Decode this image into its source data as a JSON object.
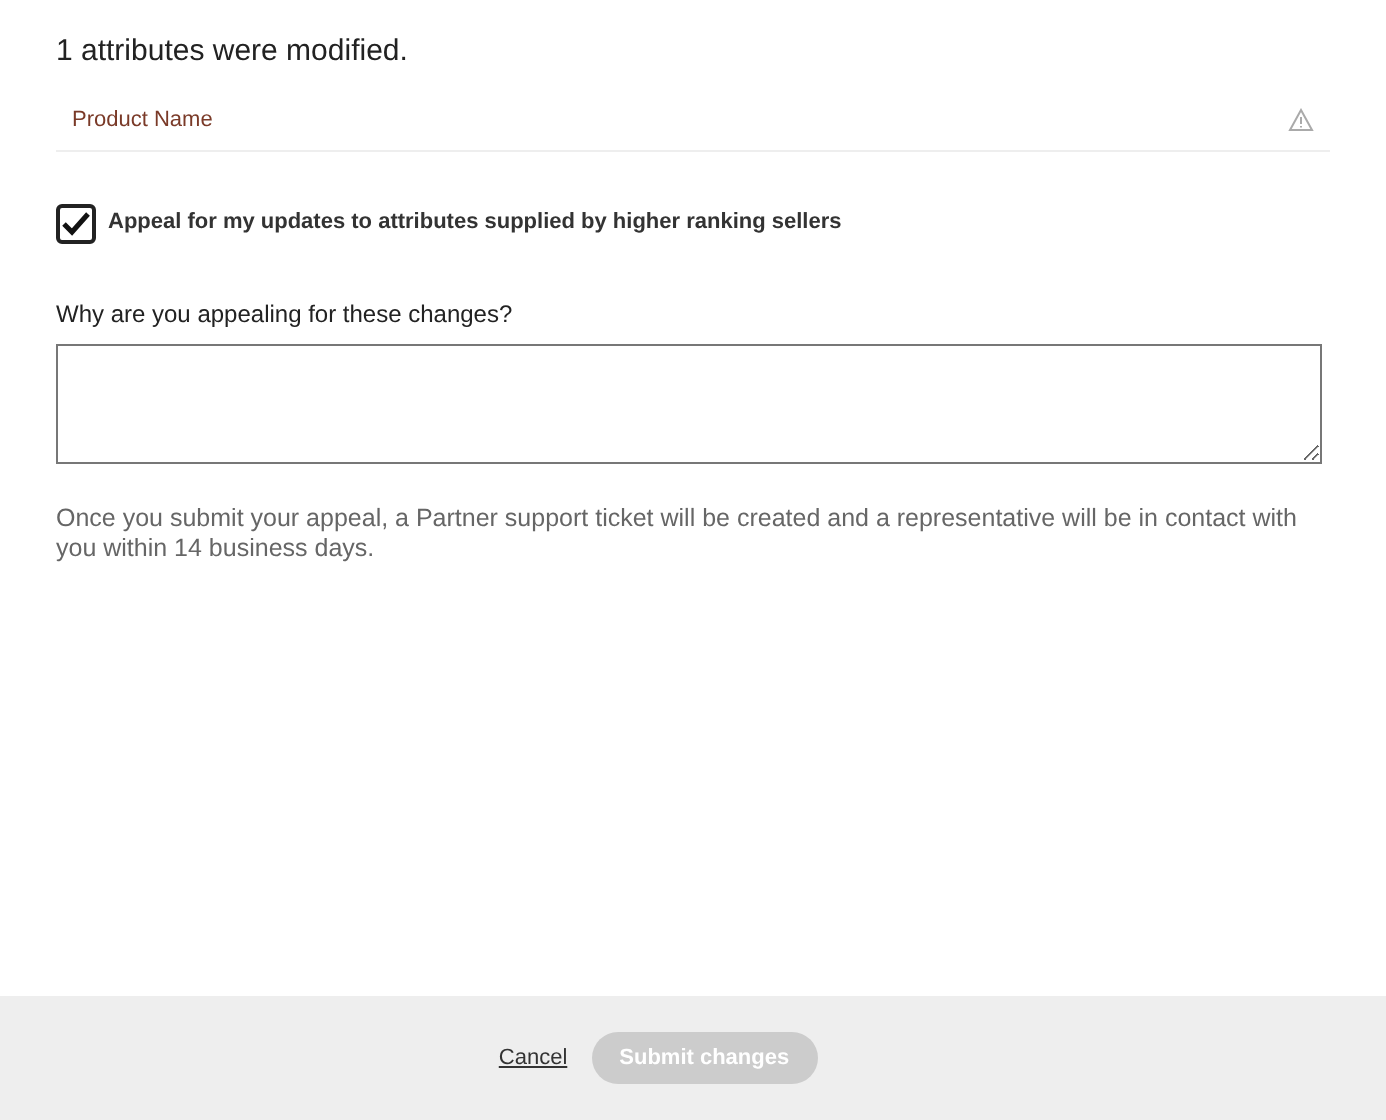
{
  "summary": "1 attributes were modified.",
  "attributes": [
    {
      "name": "Product Name",
      "warning": true
    }
  ],
  "appeal_checkbox": {
    "label": "Appeal for my updates to attributes supplied by higher ranking sellers",
    "checked": true
  },
  "reason_field": {
    "label": "Why are you appealing for these changes?"
  },
  "notice": "Once you submit your appeal, a Partner support ticket will be created and a representative will be in contact with you within 14 business days.",
  "footer": {
    "cancel": "Cancel",
    "submit": {
      "label": "Submit changes",
      "disabled": true
    }
  }
}
